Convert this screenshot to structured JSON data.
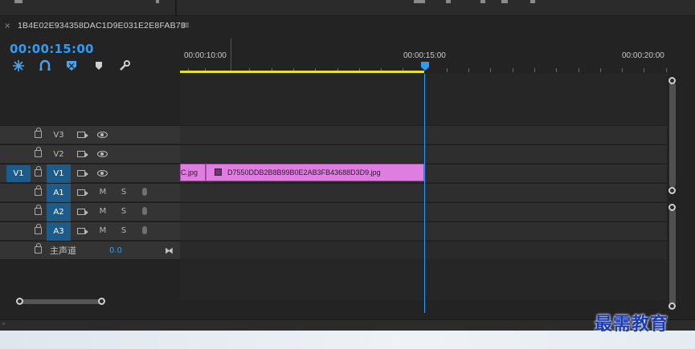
{
  "sequence": {
    "tab_title": "1B4E02E934358DAC1D9E031E2E8FAB78",
    "close_glyph": "×",
    "menu_glyph": "≡",
    "timecode": "00:00:15:00"
  },
  "tools": [
    "snap-in-timeline-icon",
    "linked-selection-icon",
    "add-marker-icon",
    "marker-icon",
    "timeline-settings-icon"
  ],
  "ruler": {
    "labels": [
      "00:00:10:00",
      "00:00:15:00",
      "00:00:20:00"
    ]
  },
  "tracks": {
    "video": [
      {
        "name": "V3",
        "source": ""
      },
      {
        "name": "V2",
        "source": ""
      },
      {
        "name": "V1",
        "source": "V1"
      }
    ],
    "audio": [
      {
        "name": "A1",
        "mute": "M",
        "solo": "S"
      },
      {
        "name": "A2",
        "mute": "M",
        "solo": "S"
      },
      {
        "name": "A3",
        "mute": "M",
        "solo": "S"
      }
    ],
    "master": {
      "name": "主声道",
      "value": "0.0"
    }
  },
  "clips": [
    {
      "label": "C.jpg",
      "track": "V1"
    },
    {
      "label": "D7550DDB2B8B99B0E2AB3FB43688D3D9.jpg",
      "track": "V1"
    }
  ],
  "status": {
    "text": "◦"
  },
  "watermark": "最需教育",
  "colors": {
    "accent": "#2e9bf5",
    "clip": "#e07de0",
    "work_area": "#e8df3a",
    "track_target": "#1b5c8c"
  }
}
